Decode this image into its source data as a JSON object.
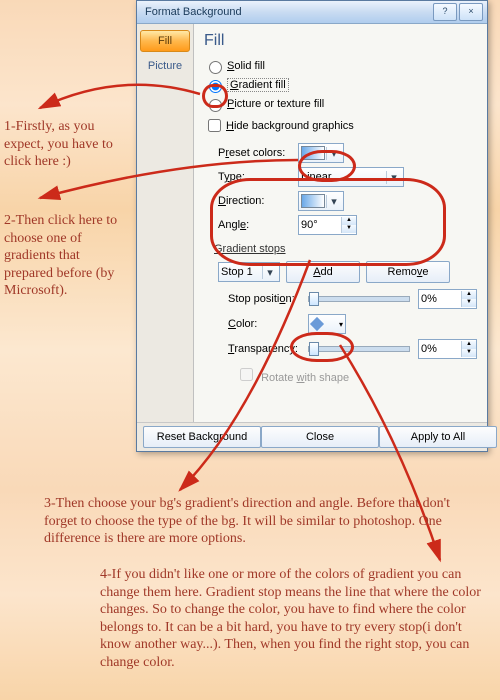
{
  "dialog": {
    "title": "Format Background",
    "help_btn": "?",
    "close_btn": "×",
    "nav": {
      "fill": "Fill",
      "picture": "Picture"
    },
    "heading": "Fill",
    "radios": {
      "solid": "Solid fill",
      "gradient": "Gradient fill",
      "picture": "Picture or texture fill"
    },
    "hide_bg": "Hide background graphics",
    "preset_label": "Preset colors:",
    "type_label": "Type:",
    "type_value": "Linear",
    "direction_label": "Direction:",
    "angle_label": "Angle:",
    "angle_value": "90°",
    "stops_label": "Gradient stops",
    "stop_selector": "Stop 1",
    "add_btn": "Add",
    "remove_btn": "Remove",
    "stop_pos_label": "Stop position:",
    "stop_pos_value": "0%",
    "color_label": "Color:",
    "transparency_label": "Transparency:",
    "transparency_value": "0%",
    "rotate_label": "Rotate with shape",
    "reset_btn": "Reset Background",
    "close_dlg_btn": "Close",
    "apply_btn": "Apply to All"
  },
  "annotations": {
    "a1": "1-Firstly, as you expect, you have to click here :)",
    "a2": "2-Then click here to choose one of gradients that prepared before (by Microsoft).",
    "a3": "3-Then choose your bg's gradient's direction and angle. Before that don't forget to choose the type of the bg. It will be similar to photoshop. One difference is there are more options.",
    "a4": "4-If you didn't like one or more of the colors of gradient you can change them here. Gradient stop means the line that where the color changes. So to change the color, you have to find where the color belongs to. It can be a bit hard, you have to try every stop(i don't know another way...). Then, when you find the right stop, you can change color."
  }
}
